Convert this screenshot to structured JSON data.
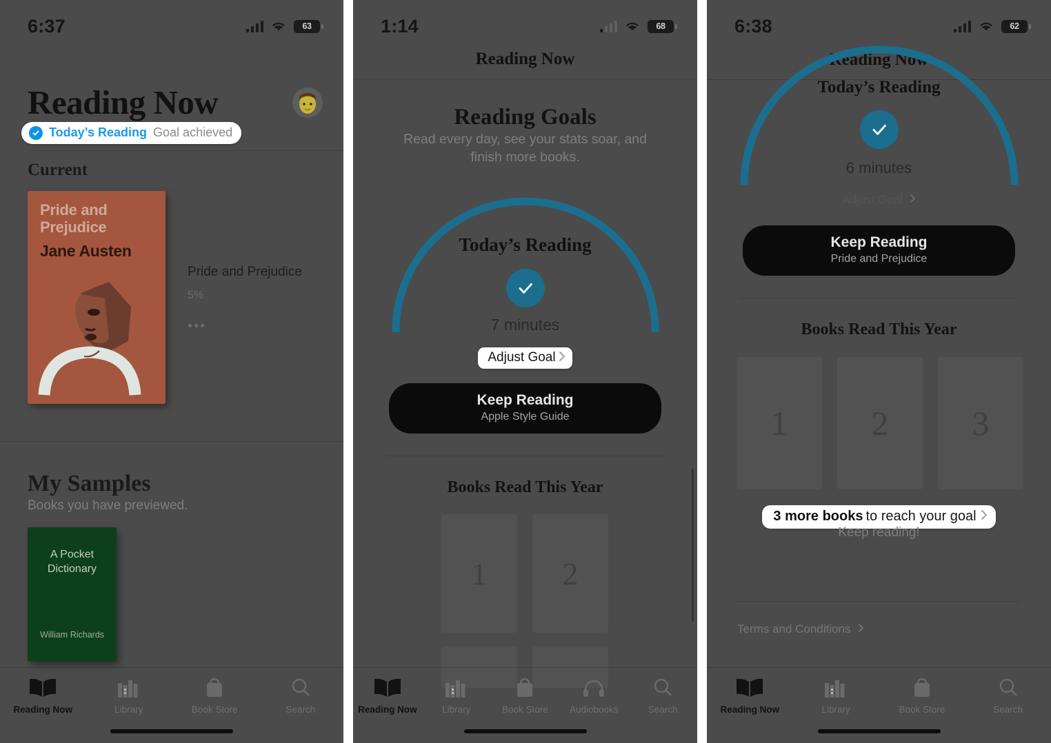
{
  "colors": {
    "arc_teal": "#1b6e8e",
    "pill_blue": "#0b93e8",
    "panel_bg": "#4b4b4b",
    "cta_black": "#0b0b0b"
  },
  "panel1": {
    "status": {
      "time": "6:37",
      "battery": "63",
      "wifi_icon": "wifi-icon",
      "signal_icon": "cellular-signal-icon"
    },
    "title": "Reading Now",
    "avatar": "user-avatar",
    "badge": {
      "strong": "Today’s Reading",
      "muted": "Goal achieved",
      "check_icon": "check-circle-icon"
    },
    "section_current": "Current",
    "current_book": {
      "cover_title_line1": "Pride and",
      "cover_title_line2": "Prejudice",
      "cover_author": "Jane Austen",
      "title": "Pride and Prejudice",
      "progress": "5%",
      "more_label": "•••"
    },
    "samples": {
      "heading": "My Samples",
      "subtitle": "Books you have previewed.",
      "book": {
        "cover_title": "A Pocket\nDictionary",
        "cover_title_line1": "A Pocket",
        "cover_title_line2": "Dictionary",
        "cover_author": "William Richards"
      }
    },
    "tabs": [
      {
        "label": "Reading Now",
        "icon": "open-book-icon",
        "active": true
      },
      {
        "label": "Library",
        "icon": "bookshelf-icon",
        "active": false
      },
      {
        "label": "Book Store",
        "icon": "shopping-bag-icon",
        "active": false
      },
      {
        "label": "Search",
        "icon": "search-icon",
        "active": false
      }
    ]
  },
  "panel2": {
    "status": {
      "time": "1:14",
      "battery": "68",
      "wifi_icon": "wifi-icon",
      "signal_icon": "cellular-signal-icon"
    },
    "nav_title": "Reading Now",
    "goals": {
      "title": "Reading Goals",
      "subtitle": "Read every day, see your stats soar, and finish more books.",
      "todays_label": "Today’s Reading",
      "check_icon": "check-mark-icon",
      "minutes": "7 minutes",
      "adjust_label": "Adjust Goal",
      "chevron_icon": "chevron-right-icon"
    },
    "cta": {
      "main": "Keep Reading",
      "sub": "Apple Style Guide"
    },
    "books_read": {
      "title": "Books Read This Year",
      "slots": [
        "1",
        "2"
      ]
    },
    "tabs": [
      {
        "label": "Reading Now",
        "icon": "open-book-icon",
        "active": true
      },
      {
        "label": "Library",
        "icon": "bookshelf-icon",
        "active": false
      },
      {
        "label": "Book Store",
        "icon": "shopping-bag-icon",
        "active": false
      },
      {
        "label": "Audiobooks",
        "icon": "headphones-icon",
        "active": false
      },
      {
        "label": "Search",
        "icon": "search-icon",
        "active": false
      }
    ]
  },
  "panel3": {
    "status": {
      "time": "6:38",
      "battery": "62",
      "wifi_icon": "wifi-icon",
      "signal_icon": "cellular-signal-icon"
    },
    "nav_title": "Reading Now",
    "goals": {
      "todays_label": "Today’s Reading",
      "check_icon": "check-mark-icon",
      "minutes": "6 minutes",
      "adjust_label": "Adjust Goal",
      "chevron_icon": "chevron-right-icon"
    },
    "cta": {
      "main": "Keep Reading",
      "sub": "Pride and Prejudice"
    },
    "books_read": {
      "title": "Books Read This Year",
      "slots": [
        "1",
        "2",
        "3"
      ]
    },
    "goal_pill": {
      "strong": "3 more books",
      "rest": " to reach your goal",
      "chevron_icon": "chevron-right-icon"
    },
    "keep_reading_note": "Keep reading!",
    "terms": "Terms and Conditions",
    "terms_chevron_icon": "chevron-right-icon",
    "tabs": [
      {
        "label": "Reading Now",
        "icon": "open-book-icon",
        "active": true
      },
      {
        "label": "Library",
        "icon": "bookshelf-icon",
        "active": false
      },
      {
        "label": "Book Store",
        "icon": "shopping-bag-icon",
        "active": false
      },
      {
        "label": "Search",
        "icon": "search-icon",
        "active": false
      }
    ]
  }
}
